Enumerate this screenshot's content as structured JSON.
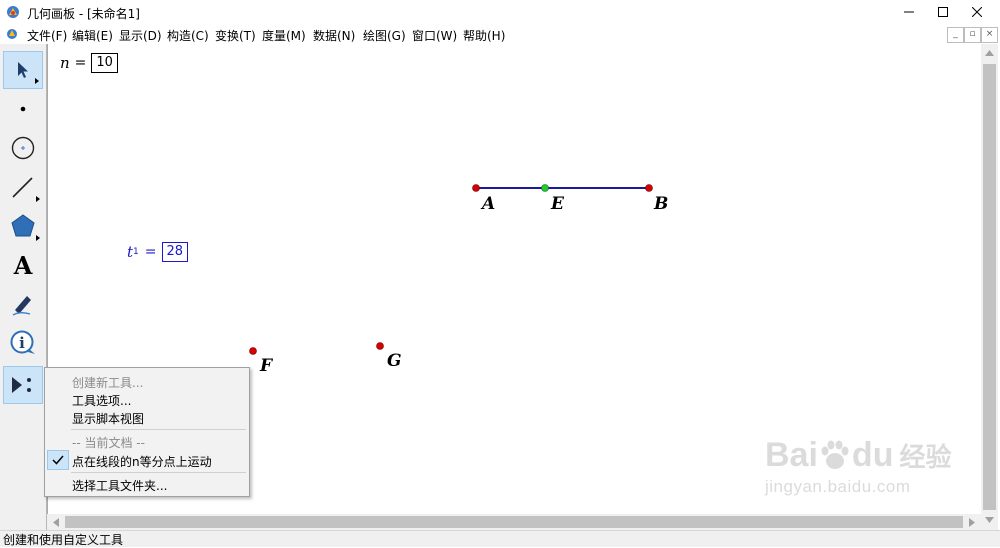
{
  "window": {
    "title": "几何画板 - [未命名1]",
    "app_icon": "geometer-sketchpad-icon",
    "controls": [
      "minimize",
      "maximize",
      "close"
    ]
  },
  "menubar": {
    "items": [
      "文件(F)",
      "编辑(E)",
      "显示(D)",
      "构造(C)",
      "变换(T)",
      "度量(M)",
      "数据(N)",
      "绘图(G)",
      "窗口(W)",
      "帮助(H)"
    ],
    "mdi_controls": [
      "_",
      "▫",
      "×"
    ]
  },
  "toolbox": {
    "tools": [
      {
        "name": "arrow-select-tool",
        "icon": "pointer-arrow-icon",
        "active": true
      },
      {
        "name": "point-tool",
        "icon": "dot-icon"
      },
      {
        "name": "compass-tool",
        "icon": "circle-icon"
      },
      {
        "name": "straightedge-tool",
        "icon": "line-icon"
      },
      {
        "name": "polygon-tool",
        "icon": "pentagon-icon"
      },
      {
        "name": "text-tool",
        "icon": "letter-a-icon",
        "glyph": "A"
      },
      {
        "name": "marker-tool",
        "icon": "pen-icon"
      },
      {
        "name": "information-tool",
        "icon": "info-icon",
        "glyph": "i"
      },
      {
        "name": "custom-tool",
        "icon": "custom-tool-icon",
        "active": true
      }
    ]
  },
  "canvas": {
    "params": [
      {
        "label": "n",
        "value": "10",
        "color": "#000000"
      },
      {
        "label": "t",
        "sub": "1",
        "value": "28",
        "color": "#1a1acc"
      }
    ],
    "eq": "=",
    "segment_color": "#1a1a99",
    "point_color": "#d80000",
    "midpoint_color": "#22cc22",
    "points": {
      "A": "A",
      "E": "E",
      "B": "B",
      "F": "F",
      "G": "G"
    }
  },
  "popup_menu": {
    "items": [
      {
        "label": "创建新工具...",
        "disabled": true
      },
      {
        "label": "工具选项..."
      },
      {
        "label": "显示脚本视图"
      },
      {
        "label": "-- 当前文档 --",
        "disabled": true
      },
      {
        "label": "点在线段的n等分点上运动",
        "checked": true
      },
      {
        "label": "选择工具文件夹..."
      }
    ]
  },
  "statusbar": {
    "text": "创建和使用自定义工具"
  },
  "watermark": {
    "brand": "Bai",
    "brand2": "du",
    "cn": "经验",
    "url": "jingyan.baidu.com"
  }
}
